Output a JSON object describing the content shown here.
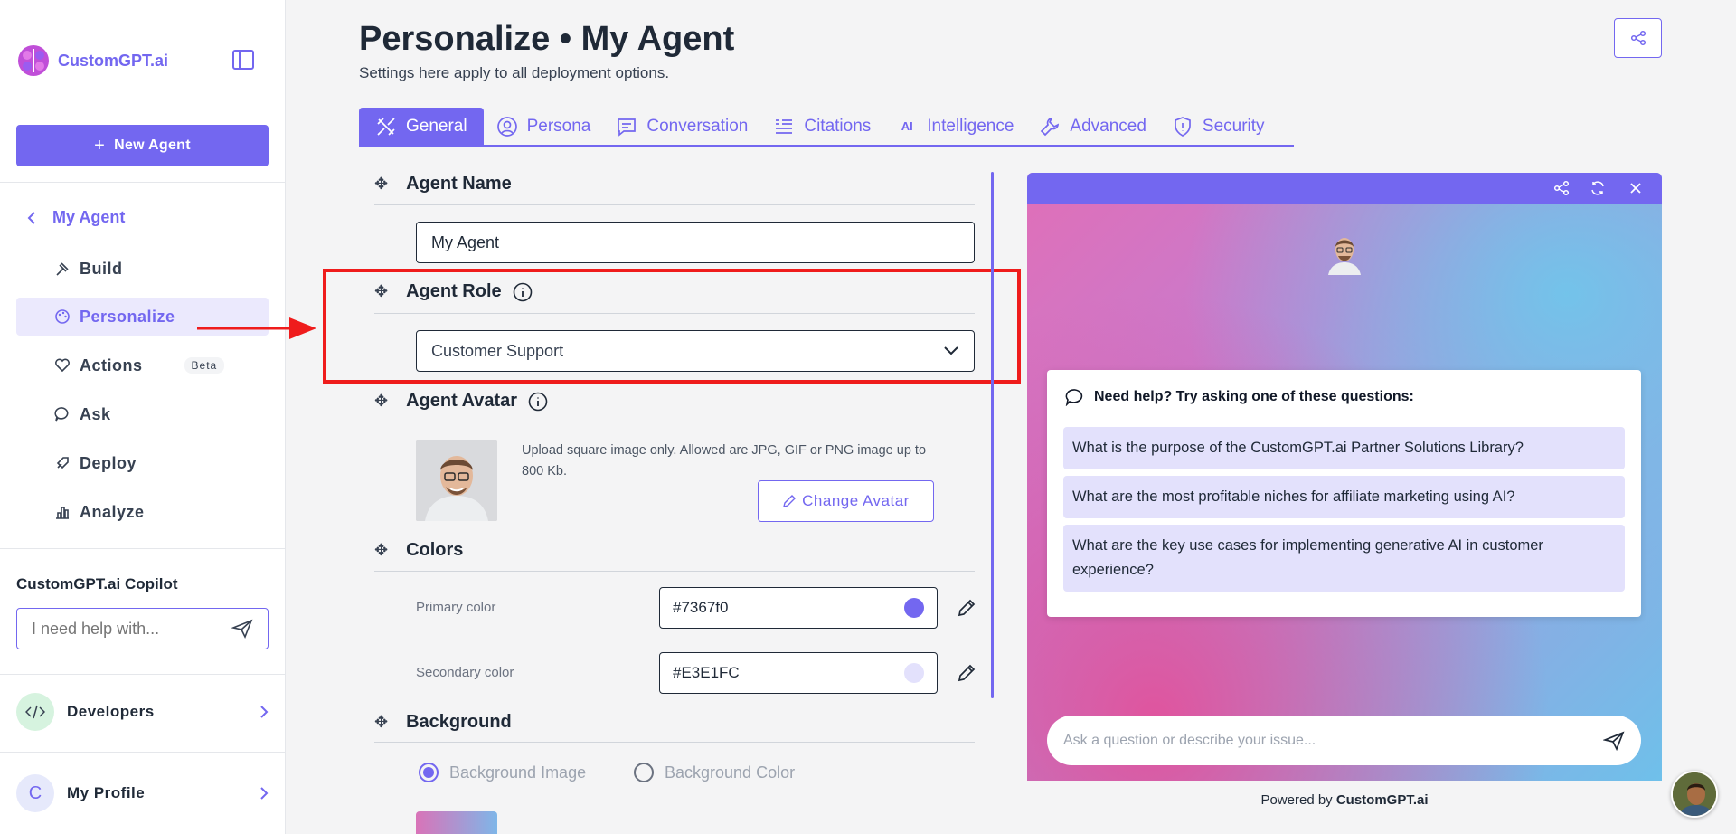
{
  "sidebar": {
    "logo_text": "CustomGPT.ai",
    "new_agent_label": "New Agent",
    "back_label": "My Agent",
    "items": [
      {
        "label": "Build",
        "icon": "build-icon"
      },
      {
        "label": "Personalize",
        "icon": "palette-icon"
      },
      {
        "label": "Actions",
        "icon": "heart-icon",
        "badge": "Beta"
      },
      {
        "label": "Ask",
        "icon": "chat-icon"
      },
      {
        "label": "Deploy",
        "icon": "rocket-icon"
      },
      {
        "label": "Analyze",
        "icon": "bar-chart-icon"
      }
    ],
    "copilot_title": "CustomGPT.ai Copilot",
    "copilot_placeholder": "I need help with...",
    "developers_label": "Developers",
    "profile_initial": "C",
    "profile_label": "My Profile"
  },
  "header": {
    "title": "Personalize • My Agent",
    "subtitle": "Settings here apply to all deployment options."
  },
  "tabs": [
    {
      "label": "General",
      "icon": "tools-icon"
    },
    {
      "label": "Persona",
      "icon": "user-circle-icon"
    },
    {
      "label": "Conversation",
      "icon": "message-icon"
    },
    {
      "label": "Citations",
      "icon": "quote-list-icon"
    },
    {
      "label": "Intelligence",
      "icon": "ai-icon",
      "icon_text": "AI"
    },
    {
      "label": "Advanced",
      "icon": "wrench-icon"
    },
    {
      "label": "Security",
      "icon": "shield-icon"
    }
  ],
  "form": {
    "agent_name_title": "Agent Name",
    "agent_name_value": "My Agent",
    "agent_role_title": "Agent Role",
    "agent_role_value": "Customer Support",
    "agent_avatar_title": "Agent Avatar",
    "upload_hint": "Upload square image only. Allowed are JPG, GIF or PNG image up to 800 Kb.",
    "change_avatar_label": "Change Avatar",
    "colors_title": "Colors",
    "primary_color_label": "Primary color",
    "primary_color_value": "#7367f0",
    "secondary_color_label": "Secondary color",
    "secondary_color_value": "#E3E1FC",
    "background_title": "Background",
    "bg_option_image": "Background Image",
    "bg_option_color": "Background Color"
  },
  "preview": {
    "card_title": "Need help? Try asking one of these questions:",
    "questions": [
      "What is the purpose of the CustomGPT.ai Partner Solutions Library?",
      "What are the most profitable niches for affiliate marketing using AI?",
      "What are the key use cases for implementing generative AI in customer experience?"
    ],
    "input_placeholder": "Ask a question or describe your issue...",
    "powered_prefix": "Powered by ",
    "powered_brand": "CustomGPT.ai"
  },
  "colors": {
    "accent": "#7367f0",
    "accent_light": "#E3E1FC",
    "highlight": "#ef1c1c"
  }
}
